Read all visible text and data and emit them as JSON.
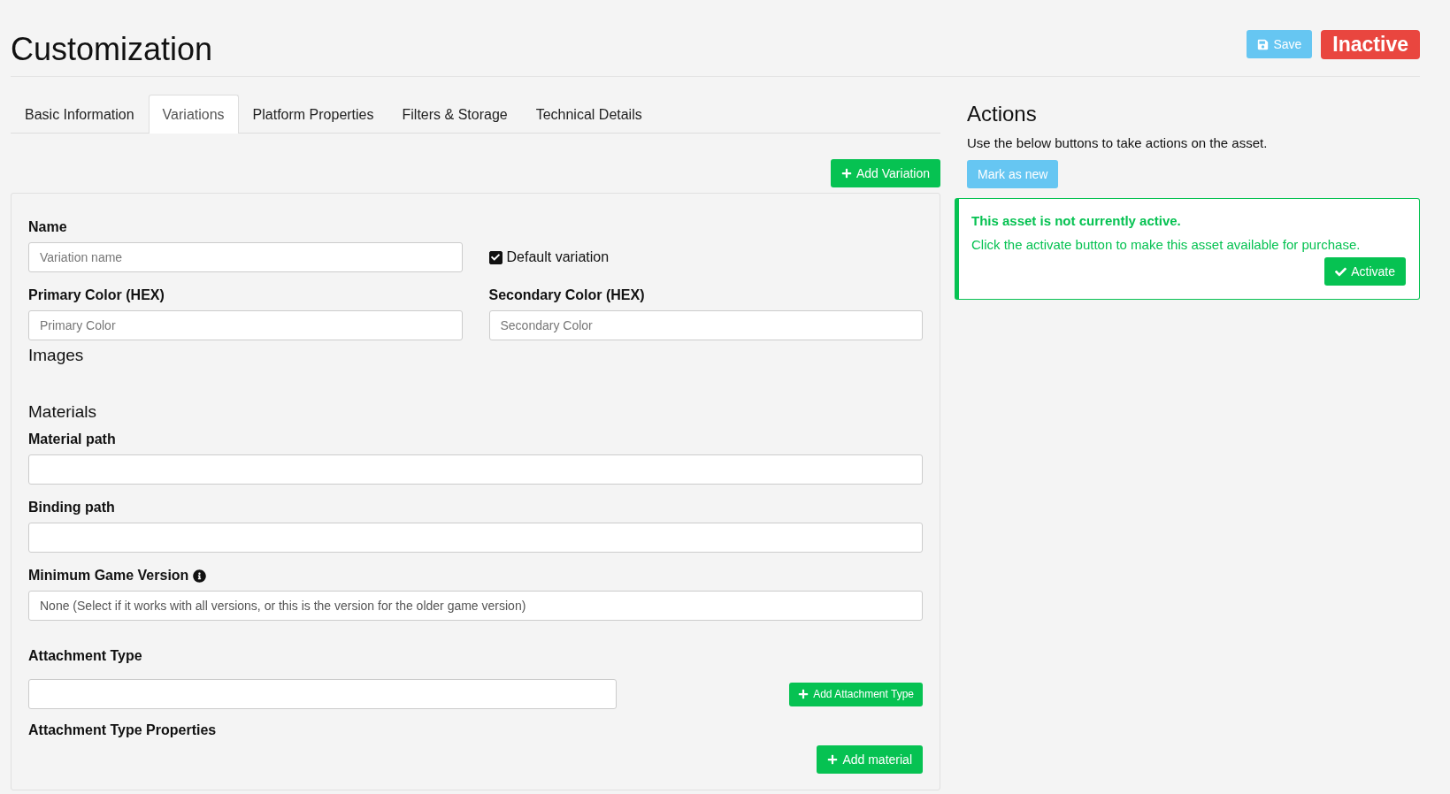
{
  "header": {
    "title": "Customization",
    "save_button": "Save",
    "status_badge": {
      "label": "Inactive",
      "active": false
    }
  },
  "tabs": [
    {
      "label": "Basic Information",
      "selected": false
    },
    {
      "label": "Variations",
      "selected": true
    },
    {
      "label": "Platform Properties",
      "selected": false
    },
    {
      "label": "Filters & Storage",
      "selected": false
    },
    {
      "label": "Technical Details",
      "selected": false
    }
  ],
  "add_variation_button": "Add Variation",
  "variation": {
    "name": {
      "label": "Name",
      "placeholder": "Variation name"
    },
    "default_variation": {
      "label": "Default variation",
      "checked": true
    },
    "primary_color": {
      "label": "Primary Color (HEX)",
      "placeholder": "Primary Color"
    },
    "secondary_color": {
      "label": "Secondary Color (HEX)",
      "placeholder": "Secondary Color"
    },
    "images_heading": "Images",
    "materials_heading": "Materials",
    "material_path": {
      "label": "Material path"
    },
    "binding_path": {
      "label": "Binding path"
    },
    "minimum_game_version": {
      "label": "Minimum Game Version",
      "value": "None (Select if it works with all versions, or this is the version for the older game version)"
    },
    "attachment_type": {
      "label": "Attachment Type",
      "button": "Add Attachment Type"
    },
    "attachment_type_properties": {
      "label": "Attachment Type Properties"
    },
    "add_material_button": "Add material"
  },
  "actions": {
    "heading": "Actions",
    "description": "Use the below buttons to take actions on the asset.",
    "mark_as_new_button": "Mark as new",
    "alert": {
      "title": "This asset is not currently active.",
      "message": "Click the activate button to make this asset available for purchase.",
      "button": "Activate"
    }
  }
}
